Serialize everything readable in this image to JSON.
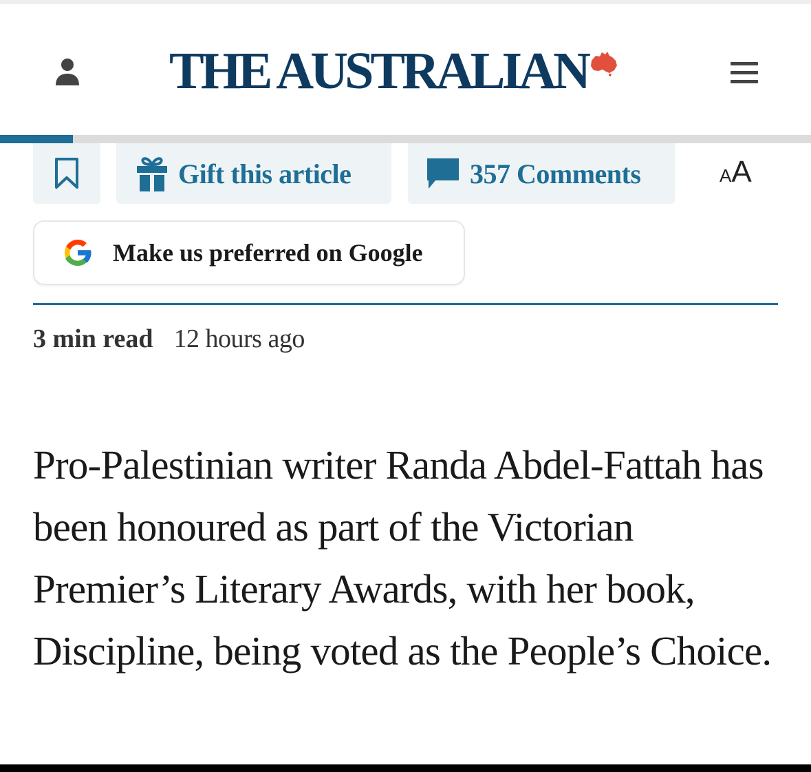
{
  "header": {
    "masthead": "THE AUSTRALIAN",
    "user_icon": "user-icon",
    "map_icon": "australia-map-icon",
    "menu_icon": "hamburger-menu-icon"
  },
  "reading_progress": 0.09,
  "toolbar": {
    "bookmark_icon": "bookmark-icon",
    "gift_icon": "gift-icon",
    "gift_label": "Gift this article",
    "comments_icon": "comment-bubble-icon",
    "comments_label": "357 Comments",
    "font_size_small": "A",
    "font_size_large": "A"
  },
  "google_preference": {
    "icon": "google-g-icon",
    "label": "Make us preferred on Google"
  },
  "article": {
    "read_time": "3 min read",
    "published": "12 hours ago",
    "standfirst": "Pro-Palestinian writer Randa Abdel-Fattah has been honoured as part of the Victorian Premier’s Literary Awards, with her book, Discipline, being voted as the People’s Choice."
  },
  "colors": {
    "brand_navy": "#0f3a5f",
    "accent_teal": "#1e6e96",
    "map_red": "#e0503c",
    "button_bg": "#eef3f5"
  }
}
